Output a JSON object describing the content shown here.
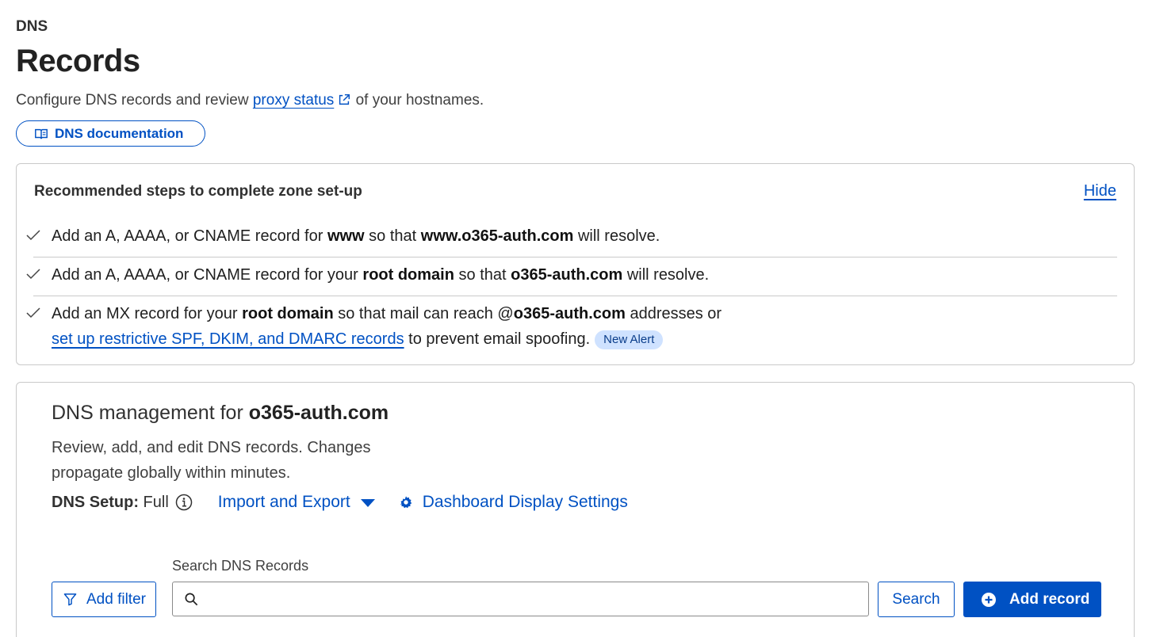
{
  "header": {
    "section": "DNS",
    "title": "Records",
    "subtitle_before": "Configure DNS records and review ",
    "subtitle_link": "proxy status",
    "subtitle_after": " of your hostnames.",
    "doc_button": "DNS documentation"
  },
  "steps": {
    "title": "Recommended steps to complete zone set-up",
    "hide_label": "Hide",
    "items": [
      {
        "t1": "Add an A, AAAA, or CNAME record for ",
        "b1": "www",
        "t2": " so that ",
        "b2": "www.o365-auth.com",
        "t3": " will resolve."
      },
      {
        "t1": "Add an A, AAAA, or CNAME record for your ",
        "b1": "root domain",
        "t2": " so that ",
        "b2": "o365-auth.com",
        "t3": " will resolve."
      },
      {
        "t1": "Add an MX record for your ",
        "b1": "root domain",
        "t2": " so that mail can reach @",
        "b2": "o365-auth.com",
        "t3": " addresses or",
        "link": "set up restrictive SPF, DKIM, and DMARC records",
        "t4": " to prevent email spoofing.",
        "badge": "New Alert"
      }
    ]
  },
  "management": {
    "title_prefix": "DNS management for ",
    "domain": "o365-auth.com",
    "description": "Review, add, and edit DNS records. Changes propagate globally within minutes.",
    "setup_label": "DNS Setup:",
    "setup_value": " Full",
    "import_export": "Import and Export",
    "display_settings": "Dashboard Display Settings",
    "search_label": "Search DNS Records",
    "search_value": "",
    "add_filter": "Add filter",
    "search_button": "Search",
    "add_record": "Add record"
  },
  "colors": {
    "accent": "#0051c3",
    "badge_bg": "#cfe2ff",
    "border": "#c9c9c9"
  }
}
